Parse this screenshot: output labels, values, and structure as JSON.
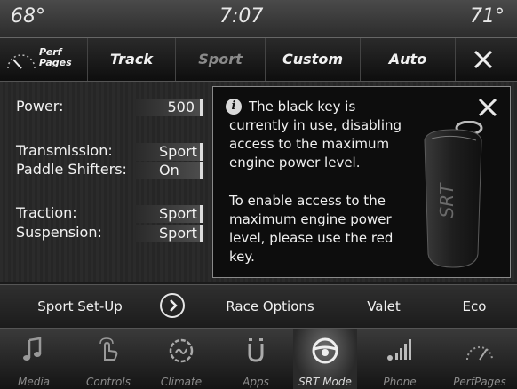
{
  "status": {
    "temp_left": "68°",
    "time": "7:07",
    "temp_right": "71°"
  },
  "modes": {
    "perf_line1": "Perf",
    "perf_line2": "Pages",
    "track": "Track",
    "sport": "Sport",
    "custom": "Custom",
    "auto": "Auto",
    "close_icon": "close-icon"
  },
  "settings": {
    "power_label": "Power:",
    "power_value": "500",
    "transmission_label": "Transmission:",
    "transmission_value": "Sport",
    "paddle_label": "Paddle Shifters:",
    "paddle_value": "On",
    "traction_label": "Traction:",
    "traction_value": "Sport",
    "suspension_label": "Suspension:",
    "suspension_value": "Sport"
  },
  "popup": {
    "info_glyph": "i",
    "message_1": "The black key is currently in use, disabling access to the maximum engine power level.",
    "message_2": "To enable access to the maximum engine power level, please use the red key.",
    "key_text": "SRT"
  },
  "options": {
    "sport_setup": "Sport Set-Up",
    "race_options": "Race Options",
    "valet": "Valet",
    "eco": "Eco"
  },
  "nav": {
    "items": [
      {
        "label": "Media",
        "icon": "music-note-icon"
      },
      {
        "label": "Controls",
        "icon": "hand-touch-icon"
      },
      {
        "label": "Climate",
        "icon": "climate-icon"
      },
      {
        "label": "Apps",
        "icon": "apps-icon"
      },
      {
        "label": "SRT Mode",
        "icon": "steering-wheel-icon"
      },
      {
        "label": "Phone",
        "icon": "phone-signal-icon"
      },
      {
        "label": "PerfPages",
        "icon": "gauge-icon"
      }
    ],
    "active": "SRT Mode"
  }
}
